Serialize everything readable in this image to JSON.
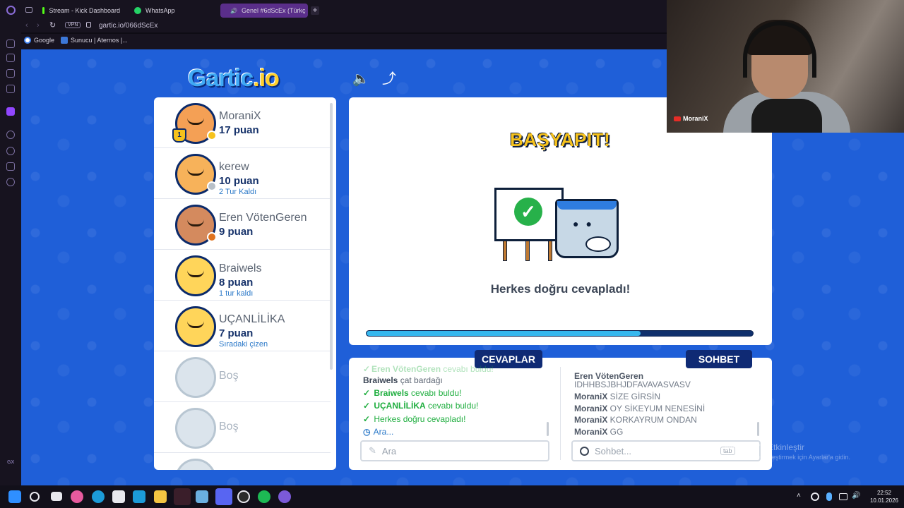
{
  "browser": {
    "tabs": [
      {
        "label": "Stream - Kick Dashboard",
        "color": "#53fc18"
      },
      {
        "label": "WhatsApp",
        "color": "#25d366"
      },
      {
        "label": "Genel #6dScEx (Türkç",
        "color": "#5bc0de"
      }
    ],
    "vpn": "VPN",
    "url": "gartic.io/066dScEx",
    "bookmarks": [
      {
        "label": "Google"
      },
      {
        "label": "Sunucu | Aternos |..."
      }
    ]
  },
  "game": {
    "logo_main": "Gartic",
    "logo_suffix": ".io",
    "players": [
      {
        "name": "MoraniX",
        "score": "17 puan",
        "sub": "",
        "dot": "#f6c21c",
        "avatar": "#f4a055"
      },
      {
        "name": "kerew",
        "score": "10 puan",
        "sub": "2 Tur Kaldı",
        "dot": "#b8c0c8",
        "avatar": "#f7b25a"
      },
      {
        "name": "Eren VötenGeren",
        "score": "9 puan",
        "sub": "",
        "dot": "#e0731e",
        "avatar": "#d48a5e"
      },
      {
        "name": "Braiwels",
        "score": "8 puan",
        "sub": "1 tur kaldı",
        "dot": "",
        "avatar": "#ffd55a"
      },
      {
        "name": "UÇANLİLİKA",
        "score": "7 puan",
        "sub": "Sıradaki çizen",
        "dot": "",
        "avatar": "#ffd55a"
      }
    ],
    "empty_slot_label": "Boş",
    "banner": "BAŞYAPIT!",
    "message": "Herkes doğru cevapladı!",
    "progress": 0.71,
    "answers_tab": "CEVAPLAR",
    "chat_tab": "SOHBET",
    "answers": [
      {
        "name": "Eren VötenGeren",
        "text": " cevabı buldu!",
        "type": "faded"
      },
      {
        "name": "Braiwels",
        "text": " çat bardağı",
        "type": "guess"
      },
      {
        "name": "Braiwels",
        "text": " cevabı buldu!",
        "type": "ok"
      },
      {
        "name": "UÇANLİLİKA",
        "text": " cevabı buldu!",
        "type": "ok"
      },
      {
        "name": "",
        "text": "Herkes doğru cevapladı!",
        "type": "ok"
      },
      {
        "name": "",
        "text": "Ara...",
        "type": "info"
      }
    ],
    "chat": [
      {
        "name": "Eren VötenGeren",
        "text": "IDHHBSJBHJDFAVAVASVASV",
        "wrap": true
      },
      {
        "name": "MoraniX",
        "text": " SİZE GİRSİN"
      },
      {
        "name": "MoraniX",
        "text": " OY SİKEYUM NENESİNİ"
      },
      {
        "name": "MoraniX",
        "text": " KORKAYRUM ONDAN"
      },
      {
        "name": "MoraniX",
        "text": " GG"
      }
    ],
    "answer_placeholder": "Ara",
    "chat_placeholder": "Sohbet...",
    "tab_key": "tab"
  },
  "webcam": {
    "label": "MoraniX"
  },
  "watermark": {
    "title": "Windows'u Etkinleştir",
    "sub": "Windows'u etkinleştirmek için Ayarlar'a gidin."
  },
  "taskbar": {
    "time": "22:52",
    "date": "10.01.2026"
  }
}
